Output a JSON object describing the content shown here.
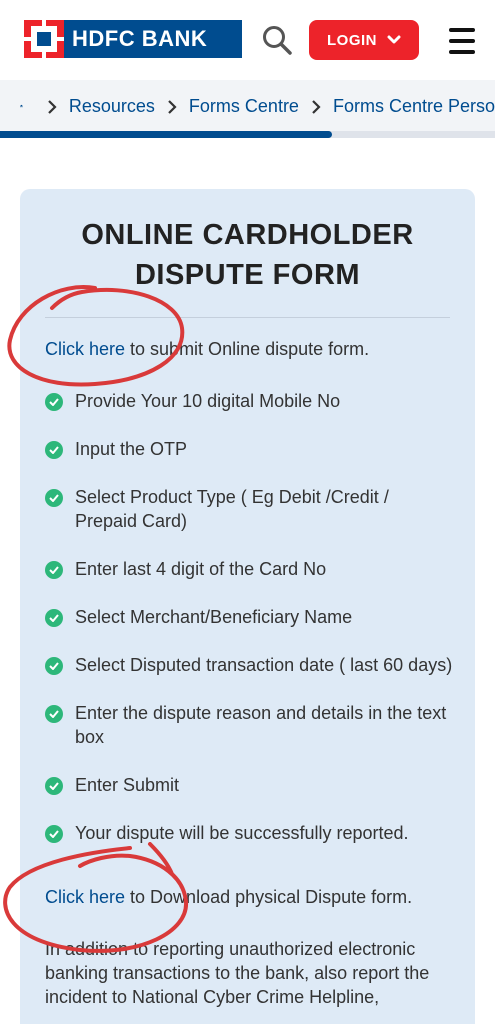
{
  "header": {
    "logo_text": "HDFC BANK",
    "login_label": "LOGIN",
    "colors": {
      "brand_blue": "#004c8f",
      "brand_red": "#ed232a"
    }
  },
  "breadcrumb": {
    "items": [
      "Resources",
      "Forms Centre",
      "Forms Centre Perso"
    ],
    "progress": 0.67
  },
  "card": {
    "title_line1": "ONLINE CARDHOLDER",
    "title_line2": "DISPUTE FORM",
    "online_link": {
      "link": "Click here",
      "rest": " to submit Online dispute form."
    },
    "steps": [
      "Provide Your 10 digital Mobile No",
      "Input the OTP",
      "Select Product Type ( Eg Debit /Credit / Prepaid Card)",
      "Enter last 4 digit of the Card No",
      "Select Merchant/Beneficiary Name",
      "Select Disputed transaction date ( last 60 days)",
      "Enter the dispute reason and details in the text box",
      "Enter Submit",
      "Your dispute will be successfully reported."
    ],
    "download_link": {
      "link": "Click here",
      "rest": " to Download physical Dispute form."
    },
    "paragraph": "In addition to reporting unauthorized electronic banking transactions to the bank, also report the incident to National Cyber Crime Helpline,"
  }
}
